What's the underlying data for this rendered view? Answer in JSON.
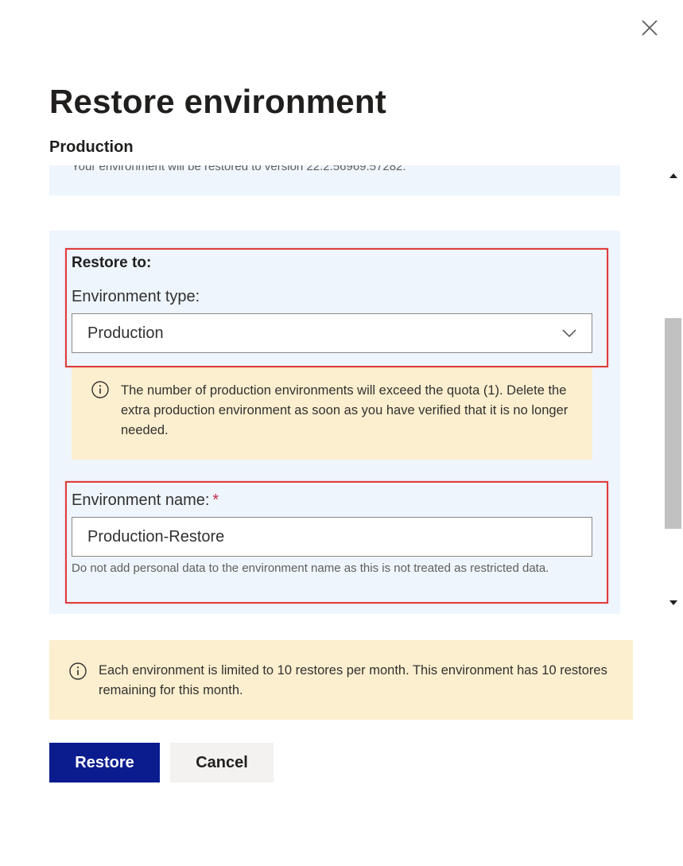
{
  "panel": {
    "title": "Restore environment",
    "subtitle": "Production",
    "close_icon": "close-icon"
  },
  "version": {
    "text": "Your environment will be restored to version 22.2.56969.57282."
  },
  "restore_to": {
    "heading": "Restore to:",
    "env_type_label": "Environment type:",
    "env_type_value": "Production",
    "quota_warning": "The number of production environments will exceed the quota (1). Delete the extra production environment as soon as you have verified that it is no longer needed.",
    "env_name_label": "Environment name:",
    "required_marker": "*",
    "env_name_value": "Production-Restore",
    "env_name_help": "Do not add personal data to the environment name as this is not treated as restricted data."
  },
  "restore_limit_info": {
    "text": "Each environment is limited to 10 restores per month. This environment has 10 restores remaining for this month."
  },
  "actions": {
    "restore_label": "Restore",
    "cancel_label": "Cancel"
  },
  "colors": {
    "primary_button": "#0b1c8f",
    "highlight_border": "#e03c3c",
    "info_background": "#fcefcf",
    "section_background": "#eef5fd"
  }
}
